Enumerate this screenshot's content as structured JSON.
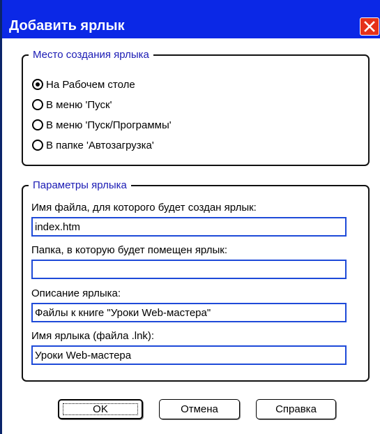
{
  "window": {
    "title": "Добавить ярлык",
    "accent": "#0b28e6"
  },
  "location_group": {
    "legend": "Место создания ярлыка",
    "options": [
      {
        "label": "На Рабочем столе",
        "checked": true
      },
      {
        "label": "В меню 'Пуск'",
        "checked": false
      },
      {
        "label": "В меню 'Пуск/Программы'",
        "checked": false
      },
      {
        "label": "В папке 'Автозагрузка'",
        "checked": false
      }
    ]
  },
  "params_group": {
    "legend": "Параметры ярлыка",
    "fields": [
      {
        "label": "Имя файла, для которого будет создан ярлык:",
        "value": "index.htm"
      },
      {
        "label": "Папка, в которую будет помещен ярлык:",
        "value": ""
      },
      {
        "label": "Описание ярлыка:",
        "value": "Файлы к книге \"Уроки Web-мастера\""
      },
      {
        "label": "Имя ярлыка (файла .lnk):",
        "value": "Уроки Web-мастера"
      }
    ]
  },
  "buttons": {
    "ok": "OK",
    "cancel": "Отмена",
    "help": "Справка"
  }
}
